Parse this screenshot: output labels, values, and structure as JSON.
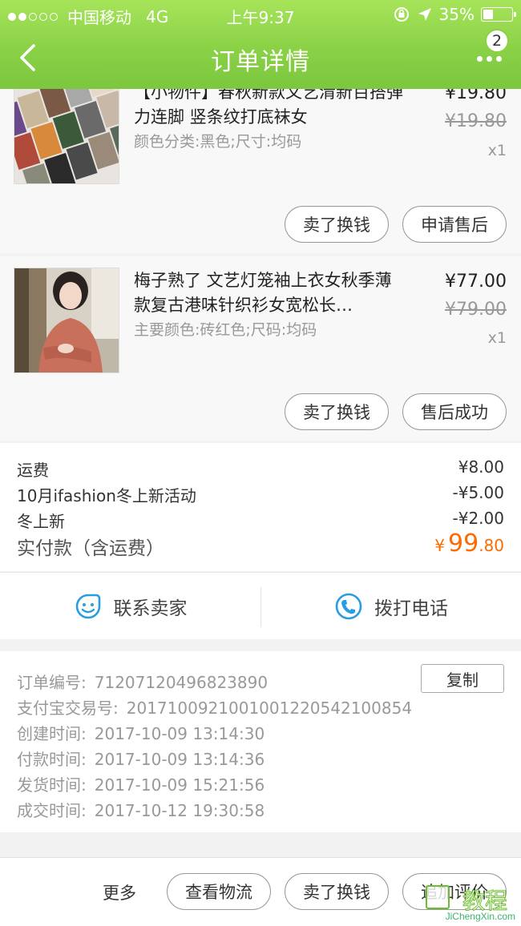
{
  "status_bar": {
    "carrier": "中国移动",
    "network": "4G",
    "time": "上午9:37",
    "battery": "35%",
    "battery_level": 0.35
  },
  "nav": {
    "title": "订单详情",
    "badge_count": "2"
  },
  "items": [
    {
      "name": "【小物件】春秋新款文艺清新百搭弹力连脚 竖条纹打底袜女",
      "spec": "颜色分类:黑色;尺寸:均码",
      "price": "¥19.80",
      "original_price": "¥19.80",
      "quantity": "x1",
      "button_left": "卖了换钱",
      "button_right": "申请售后"
    },
    {
      "name": "梅子熟了 文艺灯笼袖上衣女秋季薄款复古港味针织衫女宽松长…",
      "spec": "主要颜色:砖红色;尺码:均码",
      "price": "¥77.00",
      "original_price": "¥79.00",
      "quantity": "x1",
      "button_left": "卖了换钱",
      "button_right": "售后成功"
    }
  ],
  "fees": {
    "shipping_label": "运费",
    "shipping_value": "¥8.00",
    "promo_label": "10月ifashion冬上新活动",
    "promo_value": "-¥5.00",
    "winter_label": "冬上新",
    "winter_value": "-¥2.00",
    "total_label": "实付款（含运费）",
    "total_currency": "¥",
    "total_int": "99",
    "total_dec": ".80"
  },
  "contact": {
    "seller_label": "联系卖家",
    "phone_label": "拨打电话"
  },
  "order_info": {
    "order_no_label": "订单编号:",
    "order_no": "71207120496823890",
    "copy_label": "复制",
    "alipay_label": "支付宝交易号:",
    "alipay_no": "2017100921001001220542100854",
    "created_label": "创建时间:",
    "created": "2017-10-09 13:14:30",
    "paid_label": "付款时间:",
    "paid": "2017-10-09 13:14:36",
    "shipped_label": "发货时间:",
    "shipped": "2017-10-09 15:21:56",
    "done_label": "成交时间:",
    "done": "2017-10-12 19:30:58"
  },
  "bottom_bar": {
    "more_label": "更多",
    "logistics_label": "查看物流",
    "sell_label": "卖了换钱",
    "review_label": "追加评价"
  },
  "watermark": {
    "text": "JiChengXin.com"
  },
  "colors": {
    "header_green": "#8ad146",
    "total_orange": "#ff6a00",
    "icon_blue": "#2a9de0"
  }
}
